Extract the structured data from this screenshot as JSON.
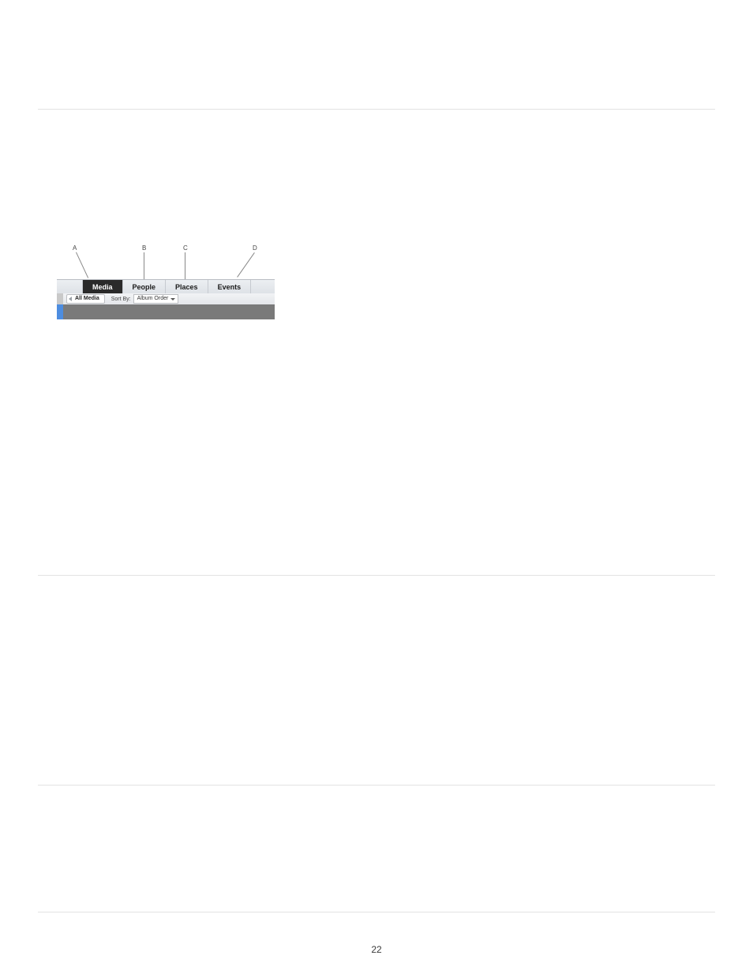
{
  "callouts": {
    "a": "A",
    "b": "B",
    "c": "C",
    "d": "D"
  },
  "tabs": {
    "media": "Media",
    "people": "People",
    "places": "Places",
    "events": "Events"
  },
  "toolbar": {
    "breadcrumb": "All Media",
    "sort_label": "Sort By:",
    "sort_value": "Album Order"
  },
  "page_number": "22"
}
